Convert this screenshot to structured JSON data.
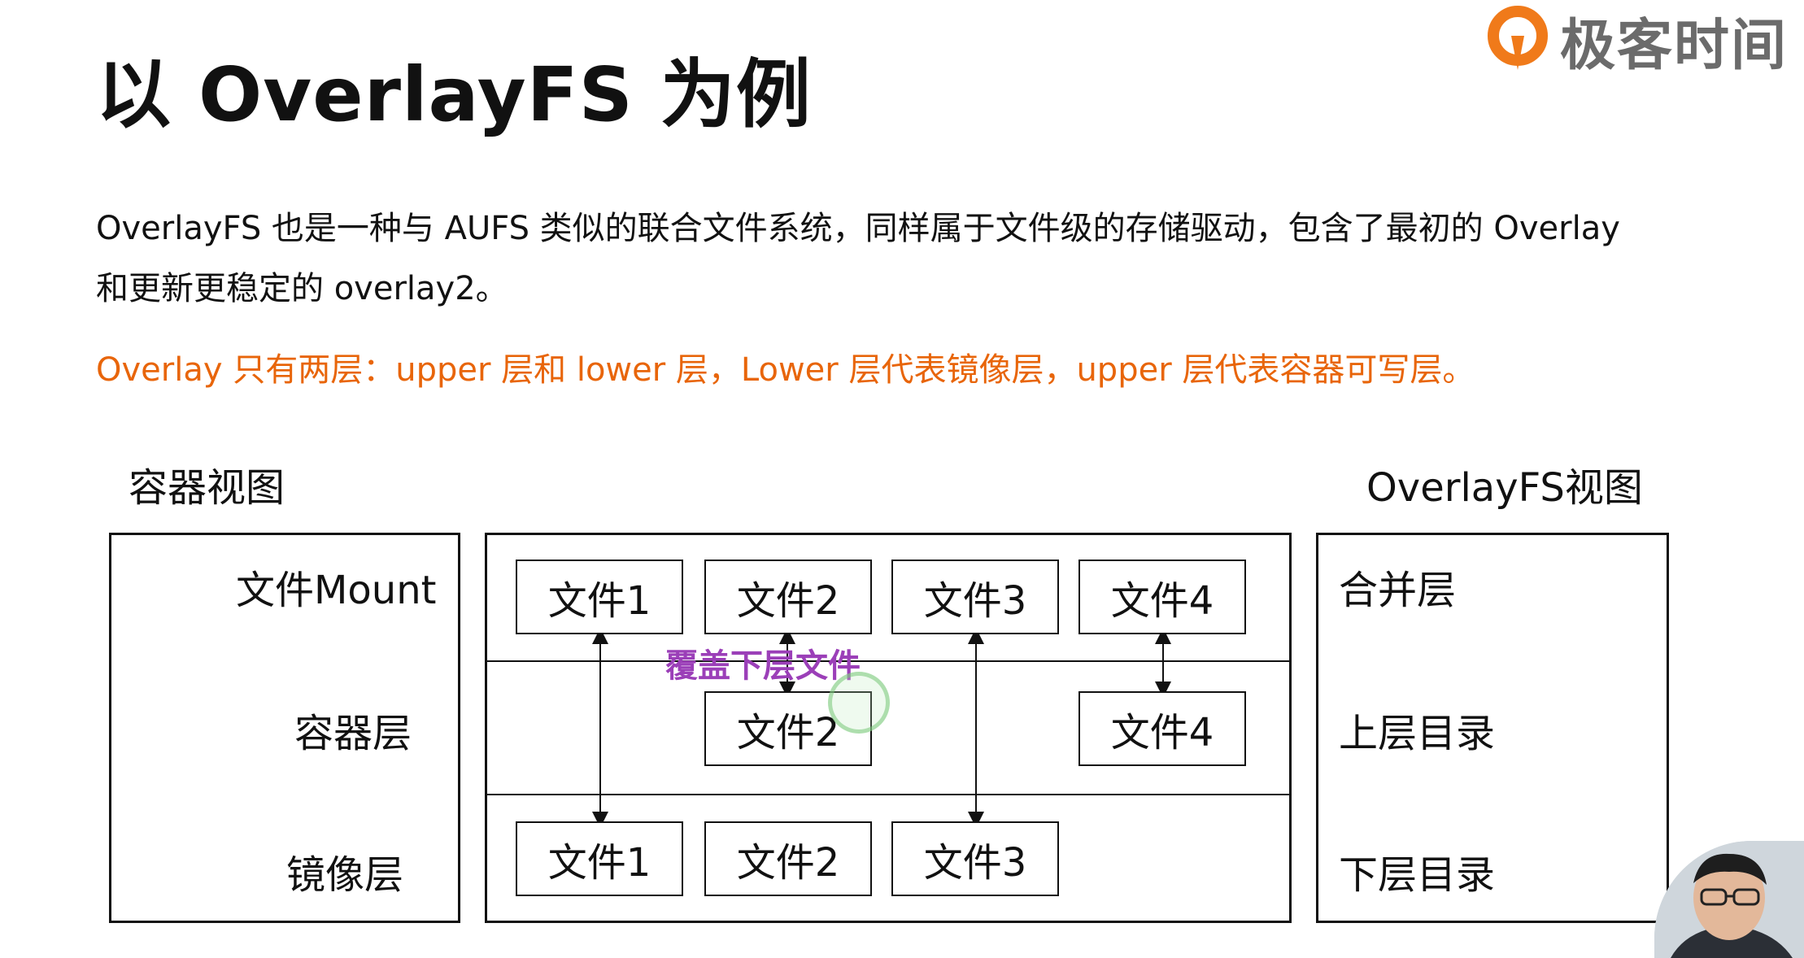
{
  "title": "以 OverlayFS 为例",
  "logo": {
    "brand": "极客时间",
    "accent": "#f07a1a"
  },
  "paragraphs": {
    "line1": "OverlayFS 也是一种与 AUFS 类似的联合文件系统，同样属于文件级的存储驱动，包含了最初的 Overlay",
    "line2": "和更新更稳定的 overlay2。",
    "highlight": "Overlay 只有两层：upper 层和 lower 层，Lower 层代表镜像层，upper 层代表容器可写层。",
    "highlight_color": "#e8650a"
  },
  "diagram": {
    "left_title": "容器视图",
    "right_title": "OverlayFS视图",
    "left_labels": [
      "文件Mount",
      "容器层",
      "镜像层"
    ],
    "right_labels": [
      "合并层",
      "上层目录",
      "下层目录"
    ],
    "mount_files": [
      "文件1",
      "文件2",
      "文件3",
      "文件4"
    ],
    "container_files": [
      "文件2",
      "文件4"
    ],
    "image_files": [
      "文件1",
      "文件2",
      "文件3"
    ],
    "annotation": "覆盖下层文件",
    "annotation_color": "#9b3fb8"
  }
}
